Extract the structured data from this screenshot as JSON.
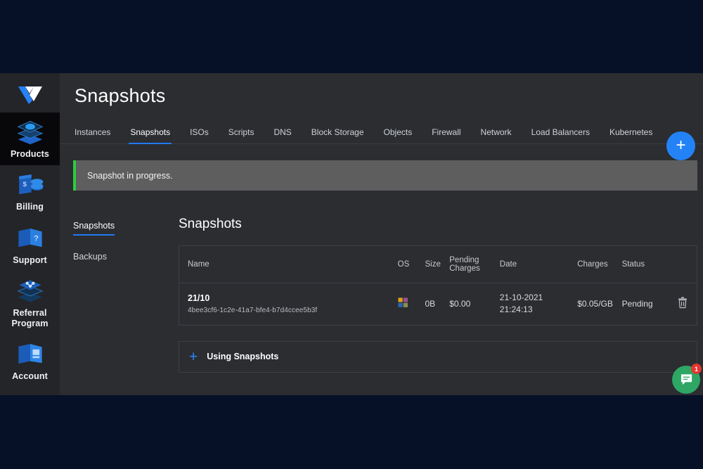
{
  "theme": {
    "accent_blue": "#2179f5",
    "alert_border_green": "#2ecc40",
    "chat_green": "#2ea664",
    "badge_red": "#e4362f",
    "app_bg": "#2b2d31",
    "rail_bg": "#242529",
    "desktop_bg": "#061127"
  },
  "rail": {
    "brand_icon": "vultr-logo-icon",
    "items": [
      {
        "label": "Products",
        "icon": "layers-icon",
        "active": true
      },
      {
        "label": "Billing",
        "icon": "billing-coins-icon",
        "active": false
      },
      {
        "label": "Support",
        "icon": "support-question-icon",
        "active": false
      },
      {
        "label": "Referral Program",
        "icon": "referral-share-icon",
        "active": false
      },
      {
        "label": "Account",
        "icon": "account-card-icon",
        "active": false
      }
    ]
  },
  "header": {
    "title": "Snapshots"
  },
  "tabs": [
    {
      "label": "Instances",
      "active": false
    },
    {
      "label": "Snapshots",
      "active": true
    },
    {
      "label": "ISOs",
      "active": false
    },
    {
      "label": "Scripts",
      "active": false
    },
    {
      "label": "DNS",
      "active": false
    },
    {
      "label": "Block Storage",
      "active": false
    },
    {
      "label": "Objects",
      "active": false
    },
    {
      "label": "Firewall",
      "active": false
    },
    {
      "label": "Network",
      "active": false
    },
    {
      "label": "Load Balancers",
      "active": false
    },
    {
      "label": "Kubernetes",
      "active": false
    }
  ],
  "fab": {
    "icon": "plus-icon",
    "label": "+"
  },
  "alert": {
    "text": "Snapshot in progress.",
    "type": "success"
  },
  "subnav": [
    {
      "label": "Snapshots",
      "active": true
    },
    {
      "label": "Backups",
      "active": false
    }
  ],
  "section": {
    "title": "Snapshots"
  },
  "table": {
    "columns": [
      {
        "label": "Name"
      },
      {
        "label": "OS"
      },
      {
        "label": "Size"
      },
      {
        "label": "Pending Charges",
        "line1": "Pending",
        "line2": "Charges"
      },
      {
        "label": "Date"
      },
      {
        "label": "Charges"
      },
      {
        "label": "Status"
      },
      {
        "label": ""
      }
    ],
    "rows": [
      {
        "name": "21/10",
        "uuid": "4bee3cf6-1c2e-41a7-bfe4-b7d4ccee5b3f",
        "os": "windows-icon",
        "size": "0B",
        "pending_charges": "$0.00",
        "date_day": "21-10-2021",
        "date_time": "21:24:13",
        "charges": "$0.05/GB",
        "status": "Pending",
        "action_icon": "trash-icon"
      }
    ]
  },
  "accordion": {
    "icon": "plus-icon",
    "label": "Using Snapshots"
  },
  "chat": {
    "icon": "chat-bubble-icon",
    "badge": "1"
  }
}
